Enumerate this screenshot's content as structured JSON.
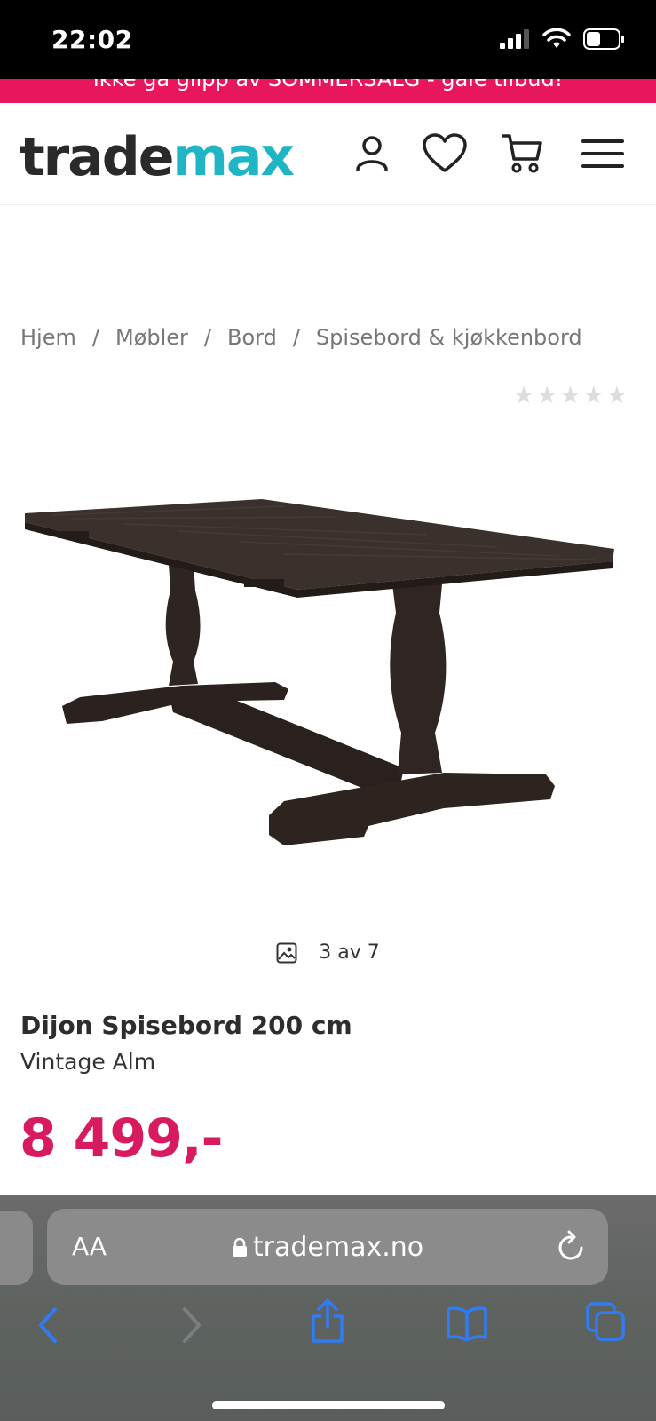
{
  "status": {
    "time": "22:02"
  },
  "promo": {
    "text": "Ikke gå glipp av SOMMERSALG - gale tilbud!"
  },
  "header": {
    "logo_part1": "trade",
    "logo_part2": "max",
    "icons": [
      "user-icon",
      "heart-icon",
      "cart-icon",
      "menu-icon"
    ]
  },
  "breadcrumb": [
    "Hjem",
    "Møbler",
    "Bord",
    "Spisebord & kjøkkenbord"
  ],
  "rating": {
    "value": 0,
    "max": 5
  },
  "gallery": {
    "counter": "3 av 7"
  },
  "product": {
    "title": "Dijon Spisebord 200 cm",
    "variant": "Vintage Alm",
    "price": "8 499,-"
  },
  "browser": {
    "text_size": "AA",
    "url": "trademax.no"
  },
  "colors": {
    "accent": "#e8175d",
    "price": "#d81b60",
    "logo_accent": "#1fb5c4",
    "ios_blue": "#2f7cf6"
  }
}
